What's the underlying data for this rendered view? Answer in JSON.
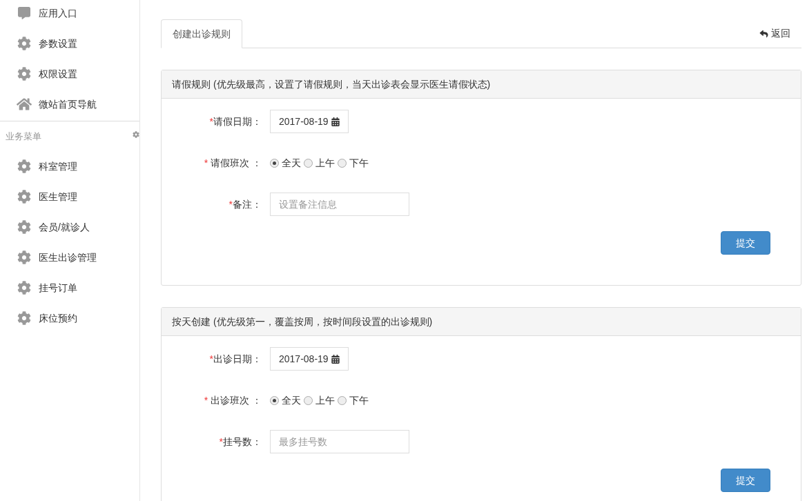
{
  "sidebar": {
    "top_items": [
      {
        "kind": "chat",
        "label": "应用入口"
      },
      {
        "kind": "gear",
        "label": "参数设置"
      },
      {
        "kind": "gear",
        "label": "权限设置"
      },
      {
        "kind": "home",
        "label": "微站首页导航"
      }
    ],
    "section_title": "业务菜单",
    "items": [
      {
        "kind": "gear",
        "label": "科室管理"
      },
      {
        "kind": "gear",
        "label": "医生管理"
      },
      {
        "kind": "gear",
        "label": "会员/就诊人"
      },
      {
        "kind": "gear",
        "label": "医生出诊管理"
      },
      {
        "kind": "gear",
        "label": "挂号订单"
      },
      {
        "kind": "gear",
        "label": "床位预约"
      }
    ]
  },
  "tabs": [
    {
      "label": "创建出诊规则",
      "selected": true
    }
  ],
  "back_link": "返回",
  "panels": [
    {
      "title": "请假规则 (优先级最高，设置了请假规则，当天出诊表会显示医生请假状态)",
      "fields": [
        {
          "kind": "date",
          "required_mark": "*",
          "label": "请假日期：",
          "value": "2017-08-19"
        },
        {
          "kind": "radio",
          "required_mark": "*",
          "label": "请假班次 ：",
          "options": [
            {
              "label": "全天",
              "selected": true
            },
            {
              "label": "上午",
              "selected": false
            },
            {
              "label": "下午",
              "selected": false
            }
          ]
        },
        {
          "kind": "text",
          "required_mark": "*",
          "label": "备注：",
          "placeholder": "设置备注信息"
        }
      ],
      "submit": "提交"
    },
    {
      "title": "按天创建 (优先级第一，覆盖按周，按时间段设置的出诊规则)",
      "fields": [
        {
          "kind": "date",
          "required_mark": "*",
          "label": "出诊日期：",
          "value": "2017-08-19"
        },
        {
          "kind": "radio",
          "required_mark": "*",
          "label": "出诊班次 ：",
          "options": [
            {
              "label": "全天",
              "selected": true
            },
            {
              "label": "上午",
              "selected": false
            },
            {
              "label": "下午",
              "selected": false
            }
          ]
        },
        {
          "kind": "text",
          "required_mark": "*",
          "label": "挂号数：",
          "placeholder": "最多挂号数"
        }
      ],
      "submit": "提交"
    }
  ]
}
